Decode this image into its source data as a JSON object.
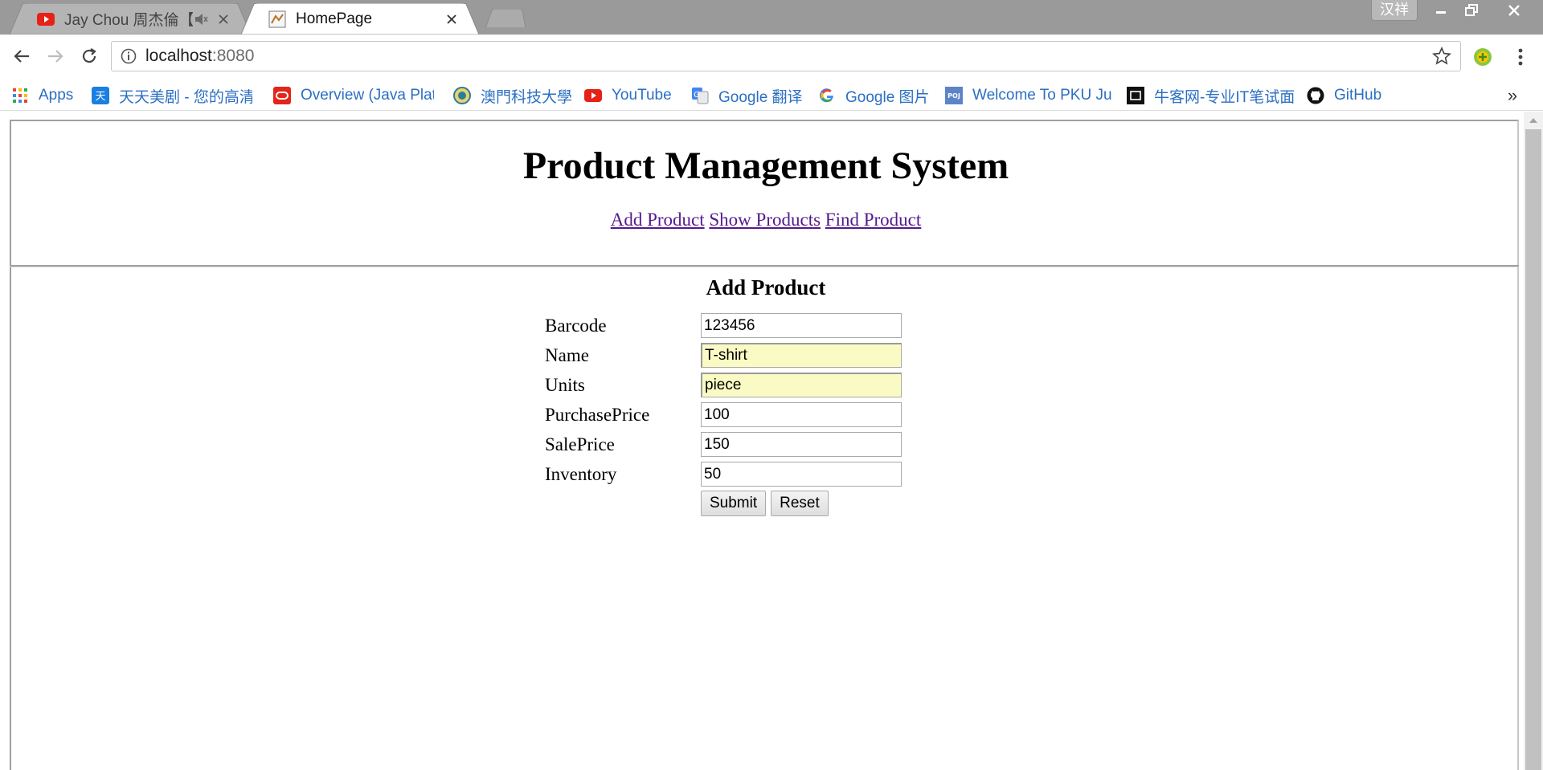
{
  "browser": {
    "tabs": [
      {
        "title": "Jay Chou 周杰倫【我",
        "icon": "youtube-icon",
        "audio": true
      },
      {
        "title": "HomePage",
        "icon": "page-favicon",
        "active": true
      }
    ],
    "profile_name": "汉祥",
    "address": {
      "host": "localhost",
      "port": ":8080"
    },
    "bookmarks": [
      {
        "label": "Apps",
        "icon": "apps-grid-icon"
      },
      {
        "label": "天天美剧 - 您的高清",
        "icon": "tiantian-icon"
      },
      {
        "label": "Overview (Java Plat",
        "icon": "oracle-icon"
      },
      {
        "label": "澳門科技大學",
        "icon": "must-icon"
      },
      {
        "label": "YouTube",
        "icon": "youtube-icon"
      },
      {
        "label": "Google 翻译",
        "icon": "google-translate-icon"
      },
      {
        "label": "Google 图片",
        "icon": "google-icon"
      },
      {
        "label": "Welcome To PKU Ju",
        "icon": "poj-icon"
      },
      {
        "label": "牛客网-专业IT笔试面",
        "icon": "nowcoder-icon"
      },
      {
        "label": "GitHub",
        "icon": "github-icon"
      }
    ],
    "bookmarks_more": "»"
  },
  "page": {
    "title": "Product Management System",
    "nav": [
      {
        "label": "Add Product"
      },
      {
        "label": "Show Products"
      },
      {
        "label": "Find Product"
      }
    ],
    "form": {
      "title": "Add Product",
      "fields": [
        {
          "label": "Barcode",
          "value": "123456"
        },
        {
          "label": "Name",
          "value": "T-shirt"
        },
        {
          "label": "Units",
          "value": "piece"
        },
        {
          "label": "PurchasePrice",
          "value": "100"
        },
        {
          "label": "SalePrice",
          "value": "150"
        },
        {
          "label": "Inventory",
          "value": "50"
        }
      ],
      "submit_label": "Submit",
      "reset_label": "Reset"
    }
  },
  "colors": {
    "link_visited": "#551a8b",
    "bookmark_text": "#2b6fc2",
    "autofill_bg": "#fafbc4"
  }
}
